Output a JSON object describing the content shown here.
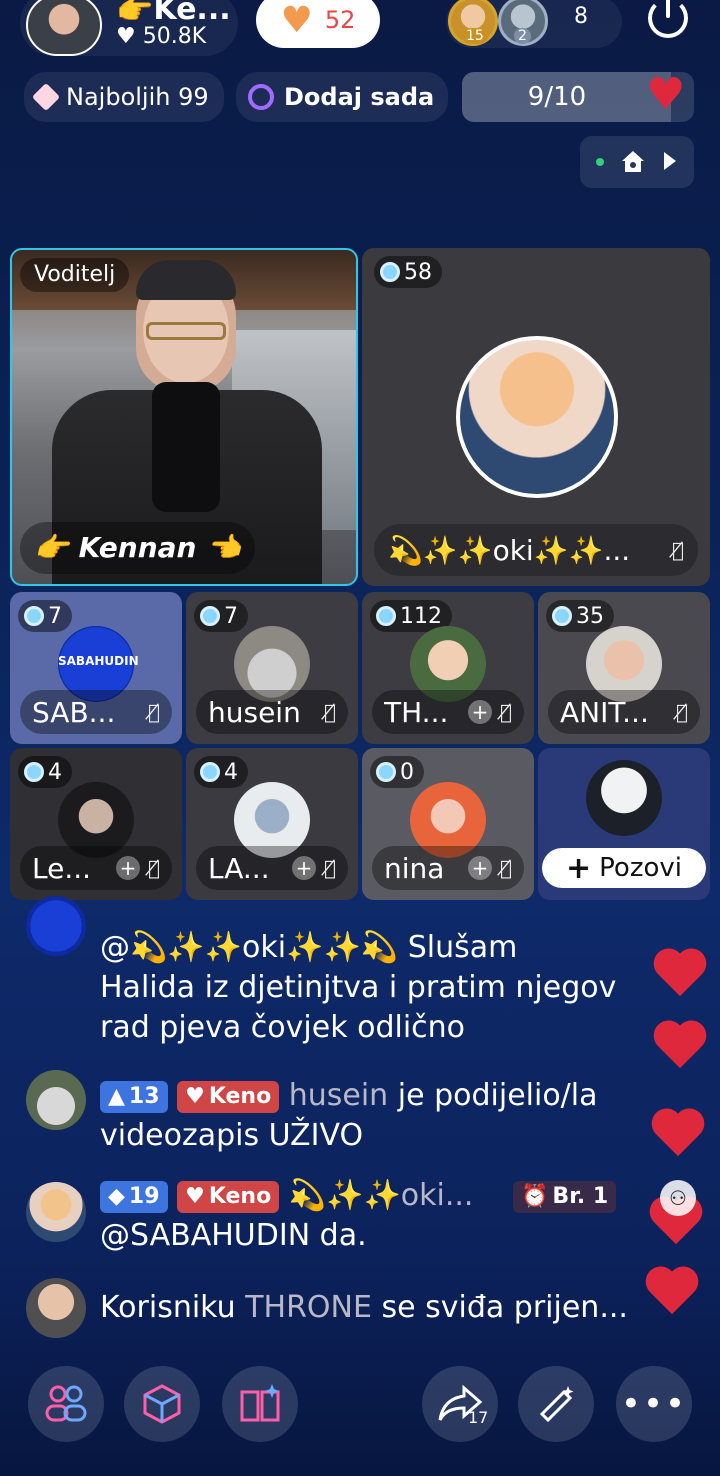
{
  "header": {
    "host_name": "Ke...",
    "host_emoji": "👉",
    "likes": "50.8K",
    "heart_count": "52",
    "viewer_badges": [
      "15",
      "2"
    ],
    "viewer_count": "8"
  },
  "subbar": {
    "top_label": "Najboljih 99",
    "add_label": "Dodaj sada",
    "progress_text": "9/10",
    "progress_fraction": 0.9
  },
  "host_tile": {
    "role": "Voditelj",
    "name": "👉 Kennan 👈"
  },
  "featured_guest": {
    "gems": "58",
    "name": "💫✨✨oki✨✨..."
  },
  "seats": [
    {
      "gems": "7",
      "name": "SAB...",
      "avatar_text": "SABAHUDIN",
      "has_plus": false
    },
    {
      "gems": "7",
      "name": "husein",
      "has_plus": false
    },
    {
      "gems": "112",
      "name": "TH...",
      "has_plus": true
    },
    {
      "gems": "35",
      "name": "ANIT...",
      "has_plus": false
    },
    {
      "gems": "4",
      "name": "Le...",
      "has_plus": true
    },
    {
      "gems": "4",
      "name": "LA...",
      "has_plus": true
    },
    {
      "gems": "0",
      "name": "nina",
      "has_plus": true
    }
  ],
  "invite": {
    "label": "Pozovi"
  },
  "chat": [
    {
      "text_a": "@💫✨✨oki✨✨💫 Slušam",
      "text_b": "Halida iz djetinjtva i pratim njegov",
      "text_c": "rad pjeva čovjek odlično"
    },
    {
      "level": "13",
      "tag": "Keno",
      "user": "husein",
      "text_a": "je podijelio/la",
      "text_b": "videozapis UŽIVO"
    },
    {
      "level": "19",
      "tag": "Keno",
      "user": "💫✨✨oki...",
      "rank": "Br. 1",
      "text_b": "@SABAHUDIN da."
    },
    {
      "prefix": "Korisniku",
      "user": "THRONE",
      "text_a": "se sviđa prijen..."
    }
  ],
  "bottom": {
    "share_count": "17"
  },
  "colors": {
    "accent_blue": "#3d74e0",
    "tag_red": "#d04545",
    "heart_red": "#e0283c",
    "host_border": "#2fc6e8"
  }
}
